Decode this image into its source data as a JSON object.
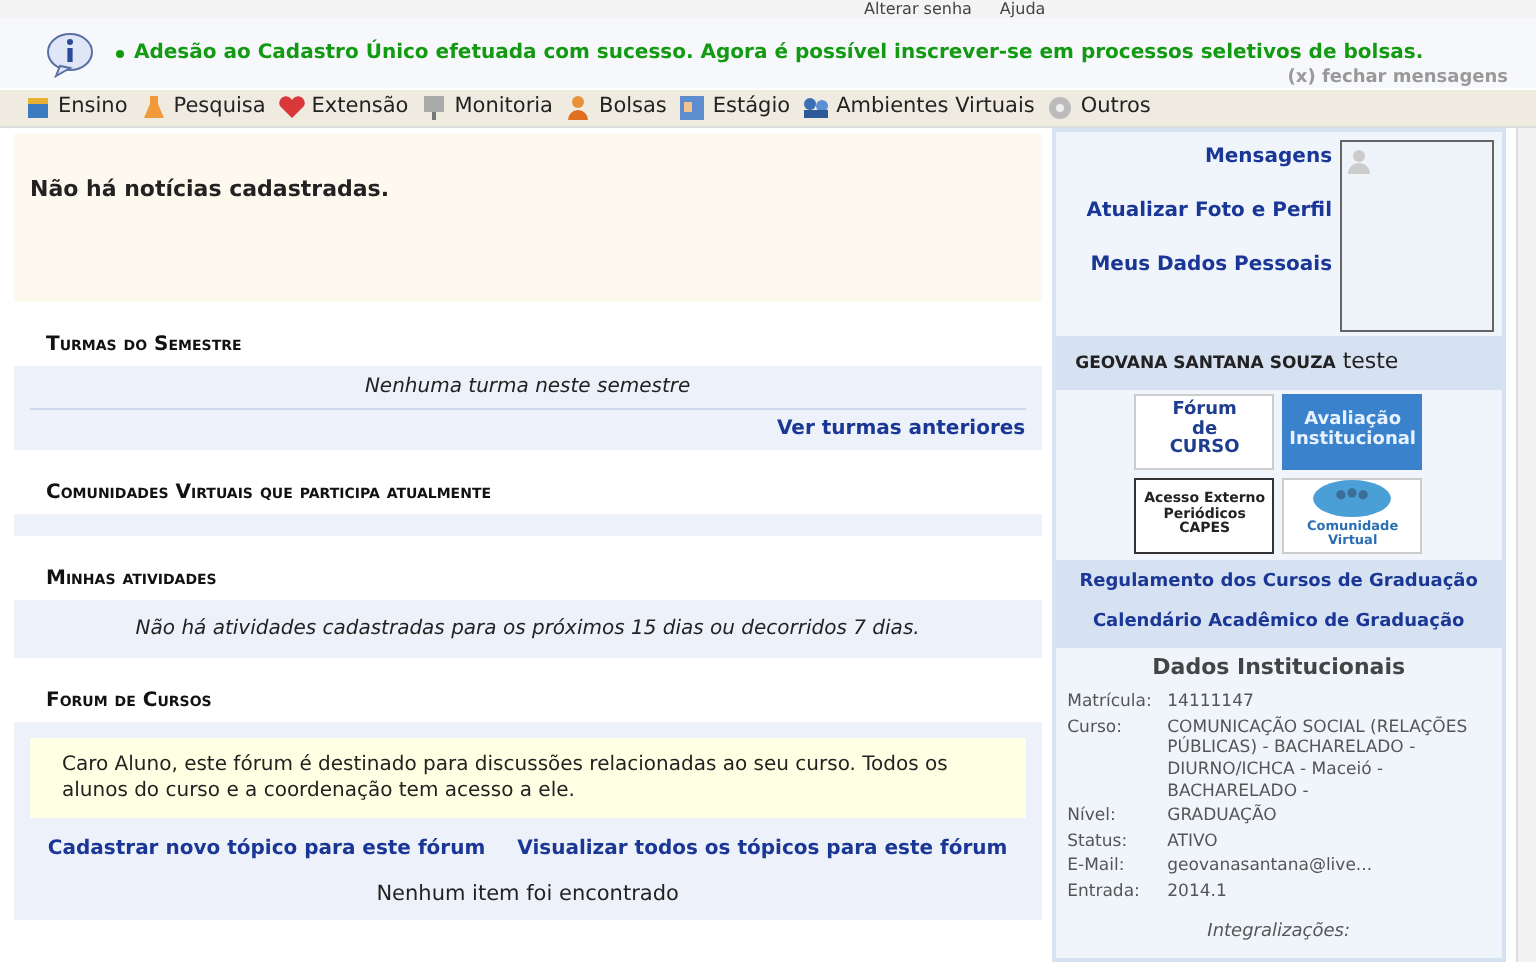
{
  "top_links": [
    "Alterar senha",
    "Ajuda"
  ],
  "message": {
    "text": "Adesão ao Cadastro Único efetuada com sucesso. Agora é possível inscrever-se em processos seletivos de bolsas.",
    "close": "(x) fechar mensagens"
  },
  "menu": [
    "Ensino",
    "Pesquisa",
    "Extensão",
    "Monitoria",
    "Bolsas",
    "Estágio",
    "Ambientes Virtuais",
    "Outros"
  ],
  "news": "Não há notícias cadastradas.",
  "sections": [
    {
      "title": "Turmas do Semestre",
      "kind": "turmas",
      "empty": "Nenhuma turma neste semestre",
      "link": "Ver turmas anteriores"
    },
    {
      "title": "Comunidades Virtuais que participa atualmente",
      "kind": "blank"
    },
    {
      "title": "Minhas atividades",
      "kind": "atividades",
      "empty": "Não há atividades cadastradas para os próximos 15 dias ou decorridos 7 dias."
    },
    {
      "title": "Forum de Cursos",
      "kind": "forum",
      "notice": "Caro Aluno, este fórum é destinado para discussões relacionadas ao seu curso. Todos os alunos do curso e a coordenação tem acesso a ele.",
      "links": [
        "Cadastrar novo tópico para este fórum",
        "Visualizar todos os tópicos para este fórum"
      ],
      "empty": "Nenhum item foi encontrado"
    }
  ],
  "sidebar": {
    "links": [
      "Mensagens",
      "Atualizar Foto e Perfil",
      "Meus Dados Pessoais"
    ],
    "user_name": "GEOVANA SANTANA SOUZA",
    "user_extra": "teste",
    "banners": [
      {
        "kind": "forum",
        "lines": [
          "Fórum",
          "de",
          "CURSO"
        ]
      },
      {
        "kind": "avaliacao",
        "lines": [
          "Avaliação",
          "Institucional"
        ]
      },
      {
        "kind": "capes",
        "lines": [
          "Acesso Externo",
          "Periódicos",
          "CAPES"
        ]
      },
      {
        "kind": "comunidade",
        "lines": [
          "Comunidade Virtual"
        ]
      }
    ],
    "bottom_links": [
      "Regulamento dos Cursos de Graduação",
      "Calendário Acadêmico de Graduação"
    ],
    "dados": {
      "title": "Dados Institucionais",
      "fields": [
        {
          "label": "Matrícula:",
          "value": "14111147"
        },
        {
          "label": "Curso:",
          "value": "COMUNICAÇÃO SOCIAL (RELAÇÕES PÚBLICAS) - BACHARELADO - DIURNO/ICHCA - Maceió - BACHARELADO -"
        },
        {
          "label": "Nível:",
          "value": "GRADUAÇÃO"
        },
        {
          "label": "Status:",
          "value": "ATIVO"
        },
        {
          "label": "E-Mail:",
          "value": "geovanasantana@live..."
        },
        {
          "label": "Entrada:",
          "value": "2014.1"
        }
      ],
      "footer": "Integralizações:"
    }
  }
}
